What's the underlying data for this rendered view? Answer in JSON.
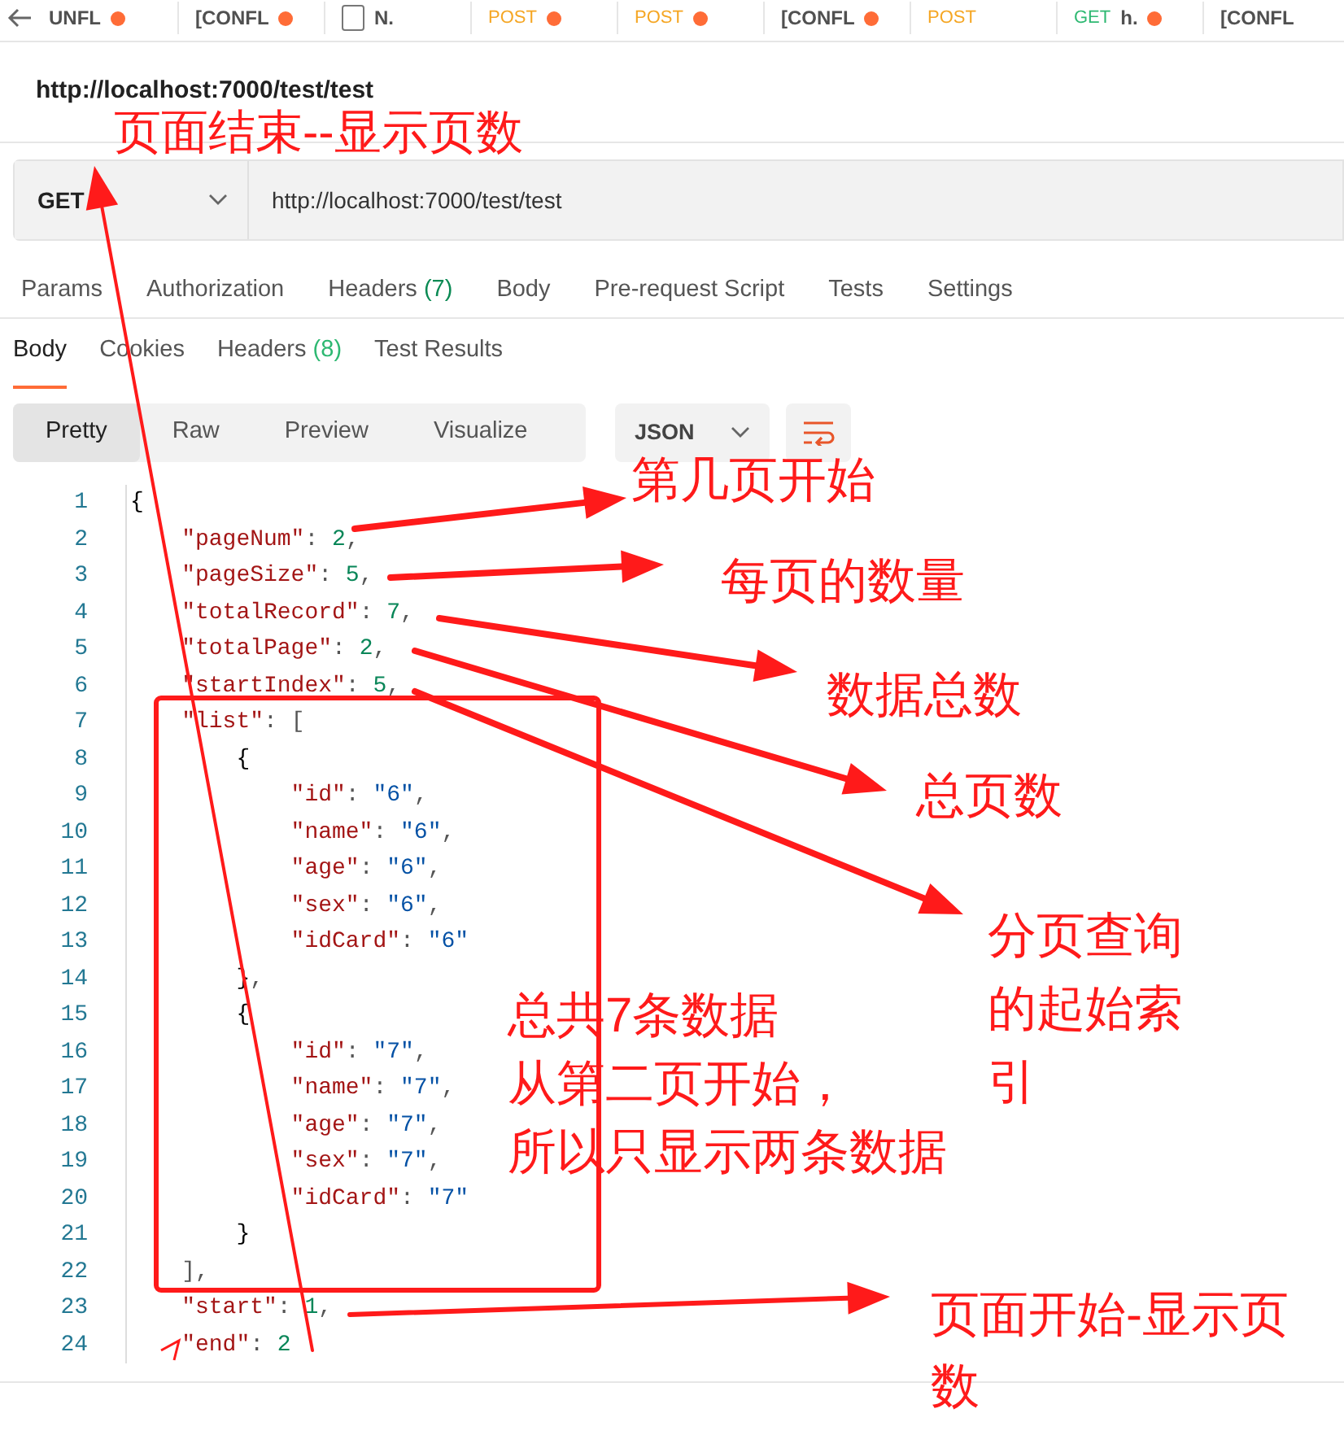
{
  "open_tabs": [
    {
      "label": "UNFL",
      "unsaved": true
    },
    {
      "label": "[CONFL",
      "unsaved": true
    },
    {
      "label": "N.",
      "unsaved": false
    },
    {
      "method": "POST",
      "unsaved": true
    },
    {
      "method": "POST",
      "unsaved": true
    },
    {
      "label": "[CONFL",
      "unsaved": true
    },
    {
      "method": "POST",
      "unsaved": false
    },
    {
      "method": "GET",
      "label": "h.",
      "unsaved": true
    },
    {
      "label": "[CONFL",
      "unsaved": false
    }
  ],
  "request_title": "http://localhost:7000/test/test",
  "request": {
    "method": "GET",
    "url": "http://localhost:7000/test/test"
  },
  "request_tabs": [
    {
      "label": "Params"
    },
    {
      "label": "Authorization"
    },
    {
      "label": "Headers",
      "count": "(7)"
    },
    {
      "label": "Body"
    },
    {
      "label": "Pre-request Script"
    },
    {
      "label": "Tests"
    },
    {
      "label": "Settings"
    }
  ],
  "response_tabs": [
    {
      "label": "Body",
      "selected": true
    },
    {
      "label": "Cookies",
      "selected": false
    },
    {
      "label": "Headers",
      "count": "(8)",
      "selected": false
    },
    {
      "label": "Test Results",
      "selected": false
    }
  ],
  "view_modes": [
    {
      "label": "Pretty",
      "selected": true
    },
    {
      "label": "Raw",
      "selected": false
    },
    {
      "label": "Preview",
      "selected": false
    },
    {
      "label": "Visualize",
      "selected": false
    }
  ],
  "format": "JSON",
  "code_lines": [
    {
      "num": "1",
      "parts": [
        {
          "kind": "brace",
          "text": "{"
        }
      ],
      "children": [
        {
          "num": "2",
          "parts": [
            {
              "kind": "key",
              "text": "\"pageNum\""
            },
            {
              "kind": "punct",
              "text": ": "
            },
            {
              "kind": "number",
              "text": "2"
            },
            {
              "kind": "punct",
              "text": ","
            }
          ]
        },
        {
          "num": "3",
          "parts": [
            {
              "kind": "key",
              "text": "\"pageSize\""
            },
            {
              "kind": "punct",
              "text": ": "
            },
            {
              "kind": "number",
              "text": "5"
            },
            {
              "kind": "punct",
              "text": ","
            }
          ]
        },
        {
          "num": "4",
          "parts": [
            {
              "kind": "key",
              "text": "\"totalRecord\""
            },
            {
              "kind": "punct",
              "text": ": "
            },
            {
              "kind": "number",
              "text": "7"
            },
            {
              "kind": "punct",
              "text": ","
            }
          ]
        },
        {
          "num": "5",
          "parts": [
            {
              "kind": "key",
              "text": "\"totalPage\""
            },
            {
              "kind": "punct",
              "text": ": "
            },
            {
              "kind": "number",
              "text": "2"
            },
            {
              "kind": "punct",
              "text": ","
            }
          ]
        },
        {
          "num": "6",
          "parts": [
            {
              "kind": "key",
              "text": "\"startIndex\""
            },
            {
              "kind": "punct",
              "text": ": "
            },
            {
              "kind": "number",
              "text": "5"
            },
            {
              "kind": "punct",
              "text": ","
            }
          ]
        },
        {
          "num": "7",
          "parts": [
            {
              "kind": "key",
              "text": "\"list\""
            },
            {
              "kind": "punct",
              "text": ": ["
            }
          ],
          "children": [
            {
              "num": "8",
              "parts": [
                {
                  "kind": "brace",
                  "text": "{"
                }
              ],
              "children": [
                {
                  "num": "9",
                  "parts": [
                    {
                      "kind": "key",
                      "text": "\"id\""
                    },
                    {
                      "kind": "punct",
                      "text": ": "
                    },
                    {
                      "kind": "string",
                      "text": "\"6\""
                    },
                    {
                      "kind": "punct",
                      "text": ","
                    }
                  ]
                },
                {
                  "num": "10",
                  "parts": [
                    {
                      "kind": "key",
                      "text": "\"name\""
                    },
                    {
                      "kind": "punct",
                      "text": ": "
                    },
                    {
                      "kind": "string",
                      "text": "\"6\""
                    },
                    {
                      "kind": "punct",
                      "text": ","
                    }
                  ]
                },
                {
                  "num": "11",
                  "parts": [
                    {
                      "kind": "key",
                      "text": "\"age\""
                    },
                    {
                      "kind": "punct",
                      "text": ": "
                    },
                    {
                      "kind": "string",
                      "text": "\"6\""
                    },
                    {
                      "kind": "punct",
                      "text": ","
                    }
                  ]
                },
                {
                  "num": "12",
                  "parts": [
                    {
                      "kind": "key",
                      "text": "\"sex\""
                    },
                    {
                      "kind": "punct",
                      "text": ": "
                    },
                    {
                      "kind": "string",
                      "text": "\"6\""
                    },
                    {
                      "kind": "punct",
                      "text": ","
                    }
                  ]
                },
                {
                  "num": "13",
                  "parts": [
                    {
                      "kind": "key",
                      "text": "\"idCard\""
                    },
                    {
                      "kind": "punct",
                      "text": ": "
                    },
                    {
                      "kind": "string",
                      "text": "\"6\""
                    }
                  ]
                }
              ]
            },
            {
              "num": "14",
              "parts": [
                {
                  "kind": "brace",
                  "text": "}"
                },
                {
                  "kind": "punct",
                  "text": ","
                }
              ]
            },
            {
              "num": "15",
              "parts": [
                {
                  "kind": "brace",
                  "text": "{"
                }
              ],
              "children": [
                {
                  "num": "16",
                  "parts": [
                    {
                      "kind": "key",
                      "text": "\"id\""
                    },
                    {
                      "kind": "punct",
                      "text": ": "
                    },
                    {
                      "kind": "string",
                      "text": "\"7\""
                    },
                    {
                      "kind": "punct",
                      "text": ","
                    }
                  ]
                },
                {
                  "num": "17",
                  "parts": [
                    {
                      "kind": "key",
                      "text": "\"name\""
                    },
                    {
                      "kind": "punct",
                      "text": ": "
                    },
                    {
                      "kind": "string",
                      "text": "\"7\""
                    },
                    {
                      "kind": "punct",
                      "text": ","
                    }
                  ]
                },
                {
                  "num": "18",
                  "parts": [
                    {
                      "kind": "key",
                      "text": "\"age\""
                    },
                    {
                      "kind": "punct",
                      "text": ": "
                    },
                    {
                      "kind": "string",
                      "text": "\"7\""
                    },
                    {
                      "kind": "punct",
                      "text": ","
                    }
                  ]
                },
                {
                  "num": "19",
                  "parts": [
                    {
                      "kind": "key",
                      "text": "\"sex\""
                    },
                    {
                      "kind": "punct",
                      "text": ": "
                    },
                    {
                      "kind": "string",
                      "text": "\"7\""
                    },
                    {
                      "kind": "punct",
                      "text": ","
                    }
                  ]
                },
                {
                  "num": "20",
                  "parts": [
                    {
                      "kind": "key",
                      "text": "\"idCard\""
                    },
                    {
                      "kind": "punct",
                      "text": ": "
                    },
                    {
                      "kind": "string",
                      "text": "\"7\""
                    }
                  ]
                }
              ]
            },
            {
              "num": "21",
              "parts": [
                {
                  "kind": "brace",
                  "text": "}"
                }
              ]
            }
          ]
        },
        {
          "num": "22",
          "parts": [
            {
              "kind": "punct",
              "text": "],"
            }
          ]
        },
        {
          "num": "23",
          "parts": [
            {
              "kind": "key",
              "text": "\"start\""
            },
            {
              "kind": "punct",
              "text": ": "
            },
            {
              "kind": "number",
              "text": "1"
            },
            {
              "kind": "punct",
              "text": ","
            }
          ]
        },
        {
          "num": "24",
          "parts": [
            {
              "kind": "key",
              "text": "\"end\""
            },
            {
              "kind": "punct",
              "text": ": "
            },
            {
              "kind": "number",
              "text": "2"
            }
          ]
        }
      ]
    }
  ],
  "annotations": [
    {
      "lines": [
        "页面结束--显示页数"
      ]
    },
    {
      "lines": [
        "第几页开始"
      ]
    },
    {
      "lines": [
        "每页的数量"
      ]
    },
    {
      "lines": [
        "数据总数"
      ]
    },
    {
      "lines": [
        "总页数"
      ]
    },
    {
      "lines": [
        "分页查询",
        "的起始索",
        "引"
      ]
    },
    {
      "lines": [
        "总共7条数据",
        "从第二页开始，",
        "所以只显示两条数据"
      ]
    },
    {
      "lines": [
        "页面开始-显示页",
        "数"
      ]
    }
  ]
}
